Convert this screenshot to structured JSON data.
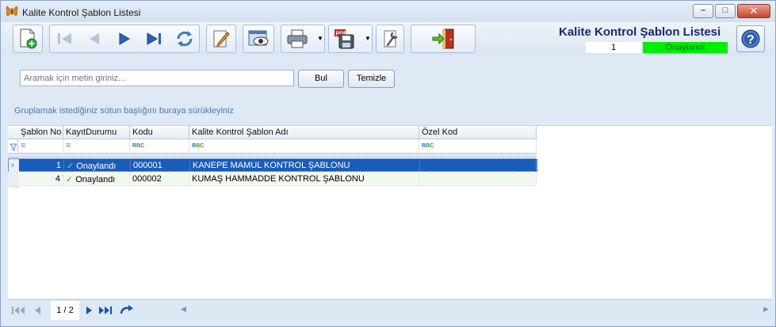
{
  "window": {
    "title": "Kalite Kontrol Şablon Listesi",
    "controls": {
      "minimize": "–",
      "maximize": "□",
      "close": "✕"
    }
  },
  "toolbar": {
    "buttons": [
      {
        "name": "new-record-button",
        "icon": "new-document-icon"
      },
      {
        "name": "first-record-button",
        "icon": "first-icon"
      },
      {
        "name": "previous-record-button",
        "icon": "previous-icon"
      },
      {
        "name": "next-record-button",
        "icon": "next-icon"
      },
      {
        "name": "last-record-button",
        "icon": "last-icon"
      },
      {
        "name": "refresh-button",
        "icon": "refresh-icon"
      },
      {
        "name": "edit-button",
        "icon": "edit-icon"
      },
      {
        "name": "preview-button",
        "icon": "preview-icon"
      },
      {
        "name": "print-button",
        "icon": "printer-icon"
      },
      {
        "name": "export-pdf-button",
        "icon": "pdf-save-icon"
      },
      {
        "name": "settings-button",
        "icon": "wrench-icon"
      },
      {
        "name": "exit-button",
        "icon": "exit-door-icon"
      }
    ]
  },
  "header": {
    "title": "Kalite Kontrol Şablon Listesi",
    "record_number": "1",
    "status": "Onaylandı"
  },
  "search": {
    "placeholder": "Aramak için metin giriniz...",
    "find_label": "Bul",
    "clear_label": "Temizle",
    "group_hint": "Gruplamak istediğiniz sütun başlığını buraya sürükleyiniz"
  },
  "grid": {
    "columns": [
      "Şablon No",
      "KayıtDurumu",
      "Kodu",
      "Kalite Kontrol Şablon Adı",
      "Özel Kod"
    ],
    "filter_placeholders": [
      "=",
      "=",
      "RBC",
      "RBC",
      "RBC"
    ],
    "rows": [
      {
        "no": "1",
        "status": "Onaylandı",
        "code": "000001",
        "name": "KANEPE MAMUL KONTROL ŞABLONU",
        "special": ""
      },
      {
        "no": "4",
        "status": "Onaylandı",
        "code": "000002",
        "name": "KUMAŞ HAMMADDE KONTROL ŞABLONU",
        "special": ""
      }
    ]
  },
  "navigator": {
    "page": "1 / 2"
  },
  "colors": {
    "accent": "#1b2a6b",
    "selected_row": "#1a5cba",
    "status_green": "#00ee00"
  }
}
